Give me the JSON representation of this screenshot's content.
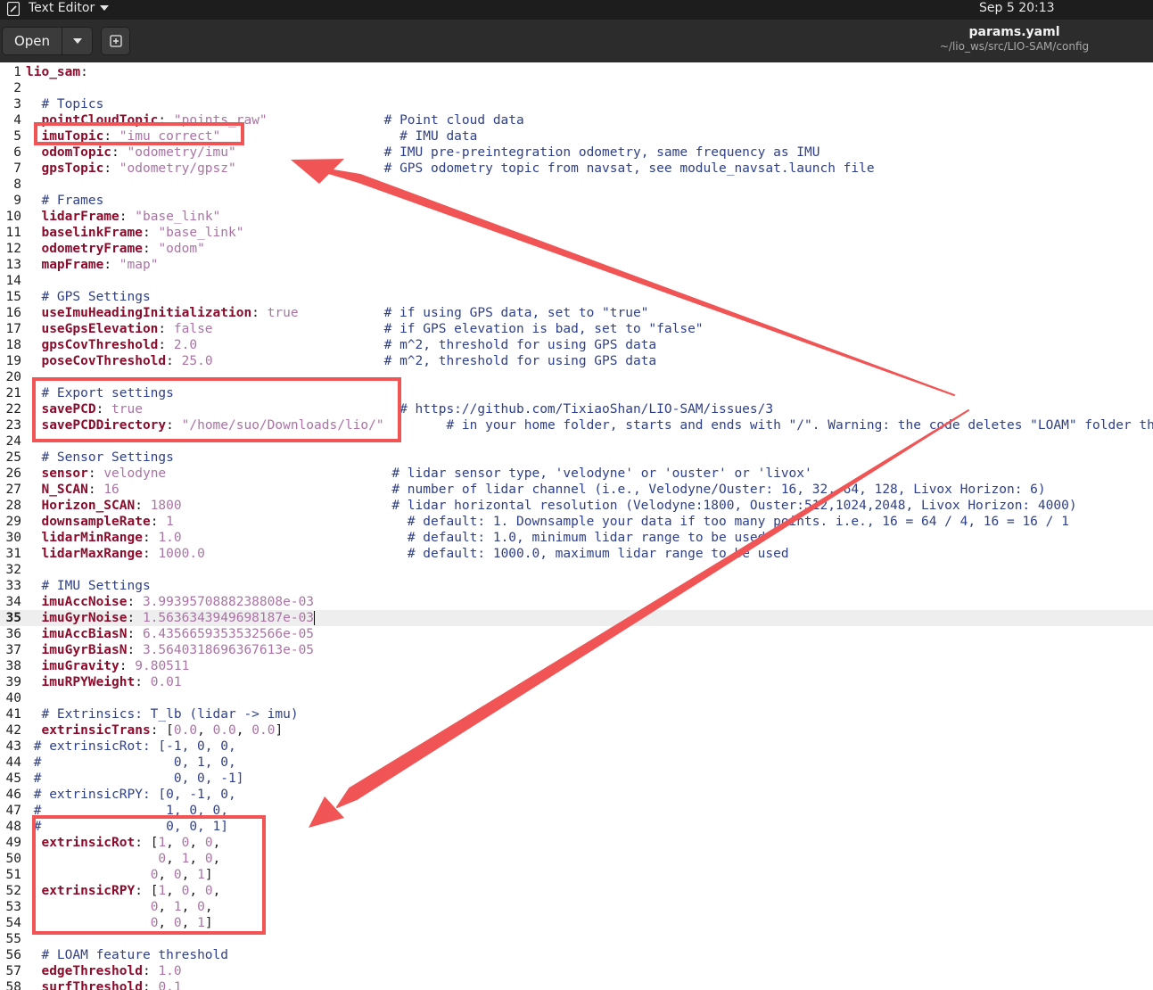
{
  "topbar": {
    "app_name": "Text Editor",
    "clock": "Sep 5  20:13"
  },
  "headerbar": {
    "open_label": "Open",
    "file_name": "params.yaml",
    "file_path": "~/lio_ws/src/LIO-SAM/config"
  },
  "colors": {
    "key": "#8b0b2b",
    "value": "#ab73a5",
    "comment": "#2e3f8c",
    "annotation": "#f05454"
  },
  "editor": {
    "current_line": 35,
    "lines": [
      {
        "n": 1,
        "parts": [
          [
            "k",
            "lio_sam"
          ],
          [
            "t",
            ":"
          ]
        ]
      },
      {
        "n": 2,
        "parts": []
      },
      {
        "n": 3,
        "parts": [
          [
            "t",
            "  "
          ],
          [
            "c",
            "# Topics"
          ]
        ]
      },
      {
        "n": 4,
        "parts": [
          [
            "t",
            "  "
          ],
          [
            "k",
            "pointCloudTopic"
          ],
          [
            "t",
            ": "
          ],
          [
            "v",
            "\"points_raw\""
          ],
          [
            "t",
            "               "
          ],
          [
            "c",
            "# Point cloud data"
          ]
        ]
      },
      {
        "n": 5,
        "parts": [
          [
            "t",
            "  "
          ],
          [
            "k",
            "imuTopic"
          ],
          [
            "t",
            ": "
          ],
          [
            "v",
            "\"imu_correct\""
          ],
          [
            "t",
            "                       "
          ],
          [
            "c",
            "# IMU data"
          ]
        ]
      },
      {
        "n": 6,
        "parts": [
          [
            "t",
            "  "
          ],
          [
            "k",
            "odomTopic"
          ],
          [
            "t",
            ": "
          ],
          [
            "v",
            "\"odometry/imu\""
          ],
          [
            "t",
            "                   "
          ],
          [
            "c",
            "# IMU pre-preintegration odometry, same frequency as IMU"
          ]
        ]
      },
      {
        "n": 7,
        "parts": [
          [
            "t",
            "  "
          ],
          [
            "k",
            "gpsTopic"
          ],
          [
            "t",
            ": "
          ],
          [
            "v",
            "\"odometry/gpsz\""
          ],
          [
            "t",
            "                   "
          ],
          [
            "c",
            "# GPS odometry topic from navsat, see module_navsat.launch file"
          ]
        ]
      },
      {
        "n": 8,
        "parts": []
      },
      {
        "n": 9,
        "parts": [
          [
            "t",
            "  "
          ],
          [
            "c",
            "# Frames"
          ]
        ]
      },
      {
        "n": 10,
        "parts": [
          [
            "t",
            "  "
          ],
          [
            "k",
            "lidarFrame"
          ],
          [
            "t",
            ": "
          ],
          [
            "v",
            "\"base_link\""
          ]
        ]
      },
      {
        "n": 11,
        "parts": [
          [
            "t",
            "  "
          ],
          [
            "k",
            "baselinkFrame"
          ],
          [
            "t",
            ": "
          ],
          [
            "v",
            "\"base_link\""
          ]
        ]
      },
      {
        "n": 12,
        "parts": [
          [
            "t",
            "  "
          ],
          [
            "k",
            "odometryFrame"
          ],
          [
            "t",
            ": "
          ],
          [
            "v",
            "\"odom\""
          ]
        ]
      },
      {
        "n": 13,
        "parts": [
          [
            "t",
            "  "
          ],
          [
            "k",
            "mapFrame"
          ],
          [
            "t",
            ": "
          ],
          [
            "v",
            "\"map\""
          ]
        ]
      },
      {
        "n": 14,
        "parts": []
      },
      {
        "n": 15,
        "parts": [
          [
            "t",
            "  "
          ],
          [
            "c",
            "# GPS Settings"
          ]
        ]
      },
      {
        "n": 16,
        "parts": [
          [
            "t",
            "  "
          ],
          [
            "k",
            "useImuHeadingInitialization"
          ],
          [
            "t",
            ": "
          ],
          [
            "v",
            "true"
          ],
          [
            "t",
            "           "
          ],
          [
            "c",
            "# if using GPS data, set to \"true\""
          ]
        ]
      },
      {
        "n": 17,
        "parts": [
          [
            "t",
            "  "
          ],
          [
            "k",
            "useGpsElevation"
          ],
          [
            "t",
            ": "
          ],
          [
            "v",
            "false"
          ],
          [
            "t",
            "                      "
          ],
          [
            "c",
            "# if GPS elevation is bad, set to \"false\""
          ]
        ]
      },
      {
        "n": 18,
        "parts": [
          [
            "t",
            "  "
          ],
          [
            "k",
            "gpsCovThreshold"
          ],
          [
            "t",
            ": "
          ],
          [
            "v",
            "2.0"
          ],
          [
            "t",
            "                        "
          ],
          [
            "c",
            "# m^2, threshold for using GPS data"
          ]
        ]
      },
      {
        "n": 19,
        "parts": [
          [
            "t",
            "  "
          ],
          [
            "k",
            "poseCovThreshold"
          ],
          [
            "t",
            ": "
          ],
          [
            "v",
            "25.0"
          ],
          [
            "t",
            "                      "
          ],
          [
            "c",
            "# m^2, threshold for using GPS data"
          ]
        ]
      },
      {
        "n": 20,
        "parts": []
      },
      {
        "n": 21,
        "parts": [
          [
            "t",
            "  "
          ],
          [
            "c",
            "# Export settings"
          ]
        ]
      },
      {
        "n": 22,
        "parts": [
          [
            "t",
            "  "
          ],
          [
            "k",
            "savePCD"
          ],
          [
            "t",
            ": "
          ],
          [
            "v",
            "true"
          ],
          [
            "t",
            "                                 "
          ],
          [
            "c",
            "# https://github.com/TixiaoShan/LIO-SAM/issues/3"
          ]
        ]
      },
      {
        "n": 23,
        "parts": [
          [
            "t",
            "  "
          ],
          [
            "k",
            "savePCDDirectory"
          ],
          [
            "t",
            ": "
          ],
          [
            "v",
            "\"/home/suo/Downloads/lio/\""
          ],
          [
            "t",
            "        "
          ],
          [
            "c",
            "# in your home folder, starts and ends with \"/\". Warning: the code deletes \"LOAM\" folder then recreates it. See \"mapOptimization\" for implementation"
          ]
        ]
      },
      {
        "n": 24,
        "parts": []
      },
      {
        "n": 25,
        "parts": [
          [
            "t",
            "  "
          ],
          [
            "c",
            "# Sensor Settings"
          ]
        ]
      },
      {
        "n": 26,
        "parts": [
          [
            "t",
            "  "
          ],
          [
            "k",
            "sensor"
          ],
          [
            "t",
            ": "
          ],
          [
            "v",
            "velodyne"
          ],
          [
            "t",
            "                             "
          ],
          [
            "c",
            "# lidar sensor type, 'velodyne' or 'ouster' or 'livox'"
          ]
        ]
      },
      {
        "n": 27,
        "parts": [
          [
            "t",
            "  "
          ],
          [
            "k",
            "N_SCAN"
          ],
          [
            "t",
            ": "
          ],
          [
            "v",
            "16"
          ],
          [
            "t",
            "                                   "
          ],
          [
            "c",
            "# number of lidar channel (i.e., Velodyne/Ouster: 16, 32, 64, 128, Livox Horizon: 6)"
          ]
        ]
      },
      {
        "n": 28,
        "parts": [
          [
            "t",
            "  "
          ],
          [
            "k",
            "Horizon_SCAN"
          ],
          [
            "t",
            ": "
          ],
          [
            "v",
            "1800"
          ],
          [
            "t",
            "                           "
          ],
          [
            "c",
            "# lidar horizontal resolution (Velodyne:1800, Ouster:512,1024,2048, Livox Horizon: 4000)"
          ]
        ]
      },
      {
        "n": 29,
        "parts": [
          [
            "t",
            "  "
          ],
          [
            "k",
            "downsampleRate"
          ],
          [
            "t",
            ": "
          ],
          [
            "v",
            "1"
          ],
          [
            "t",
            "                              "
          ],
          [
            "c",
            "# default: 1. Downsample your data if too many points. i.e., 16 = 64 / 4, 16 = 16 / 1"
          ]
        ]
      },
      {
        "n": 30,
        "parts": [
          [
            "t",
            "  "
          ],
          [
            "k",
            "lidarMinRange"
          ],
          [
            "t",
            ": "
          ],
          [
            "v",
            "1.0"
          ],
          [
            "t",
            "                             "
          ],
          [
            "c",
            "# default: 1.0, minimum lidar range to be used"
          ]
        ]
      },
      {
        "n": 31,
        "parts": [
          [
            "t",
            "  "
          ],
          [
            "k",
            "lidarMaxRange"
          ],
          [
            "t",
            ": "
          ],
          [
            "v",
            "1000.0"
          ],
          [
            "t",
            "                          "
          ],
          [
            "c",
            "# default: 1000.0, maximum lidar range to be used"
          ]
        ]
      },
      {
        "n": 32,
        "parts": []
      },
      {
        "n": 33,
        "parts": [
          [
            "t",
            "  "
          ],
          [
            "c",
            "# IMU Settings"
          ]
        ]
      },
      {
        "n": 34,
        "parts": [
          [
            "t",
            "  "
          ],
          [
            "k",
            "imuAccNoise"
          ],
          [
            "t",
            ": "
          ],
          [
            "v",
            "3.9939570888238808e-03"
          ]
        ]
      },
      {
        "n": 35,
        "parts": [
          [
            "t",
            "  "
          ],
          [
            "k",
            "imuGyrNoise"
          ],
          [
            "t",
            ": "
          ],
          [
            "v",
            "1.5636343949698187e-03"
          ],
          [
            "cursor",
            ""
          ]
        ]
      },
      {
        "n": 36,
        "parts": [
          [
            "t",
            "  "
          ],
          [
            "k",
            "imuAccBiasN"
          ],
          [
            "t",
            ": "
          ],
          [
            "v",
            "6.4356659353532566e-05"
          ]
        ]
      },
      {
        "n": 37,
        "parts": [
          [
            "t",
            "  "
          ],
          [
            "k",
            "imuGyrBiasN"
          ],
          [
            "t",
            ": "
          ],
          [
            "v",
            "3.5640318696367613e-05"
          ]
        ]
      },
      {
        "n": 38,
        "parts": [
          [
            "t",
            "  "
          ],
          [
            "k",
            "imuGravity"
          ],
          [
            "t",
            ": "
          ],
          [
            "v",
            "9.80511"
          ]
        ]
      },
      {
        "n": 39,
        "parts": [
          [
            "t",
            "  "
          ],
          [
            "k",
            "imuRPYWeight"
          ],
          [
            "t",
            ": "
          ],
          [
            "v",
            "0.01"
          ]
        ]
      },
      {
        "n": 40,
        "parts": []
      },
      {
        "n": 41,
        "parts": [
          [
            "t",
            "  "
          ],
          [
            "c",
            "# Extrinsics: T_lb (lidar -> imu)"
          ]
        ]
      },
      {
        "n": 42,
        "parts": [
          [
            "t",
            "  "
          ],
          [
            "k",
            "extrinsicTrans"
          ],
          [
            "t",
            ": ["
          ],
          [
            "v",
            "0.0"
          ],
          [
            "t",
            ", "
          ],
          [
            "v",
            "0.0"
          ],
          [
            "t",
            ", "
          ],
          [
            "v",
            "0.0"
          ],
          [
            "t",
            "]"
          ]
        ]
      },
      {
        "n": 43,
        "parts": [
          [
            "t",
            " "
          ],
          [
            "c",
            "# extrinsicRot: [-1, 0, 0,"
          ]
        ]
      },
      {
        "n": 44,
        "parts": [
          [
            "t",
            " "
          ],
          [
            "c",
            "#                 0, 1, 0,"
          ]
        ]
      },
      {
        "n": 45,
        "parts": [
          [
            "t",
            " "
          ],
          [
            "c",
            "#                 0, 0, -1]"
          ]
        ]
      },
      {
        "n": 46,
        "parts": [
          [
            "t",
            " "
          ],
          [
            "c",
            "# extrinsicRPY: [0, -1, 0,"
          ]
        ]
      },
      {
        "n": 47,
        "parts": [
          [
            "t",
            " "
          ],
          [
            "c",
            "#                1, 0, 0,"
          ]
        ]
      },
      {
        "n": 48,
        "parts": [
          [
            "t",
            " "
          ],
          [
            "c",
            "#                0, 0, 1]"
          ]
        ]
      },
      {
        "n": 49,
        "parts": [
          [
            "t",
            "  "
          ],
          [
            "k",
            "extrinsicRot"
          ],
          [
            "t",
            ": ["
          ],
          [
            "v",
            "1"
          ],
          [
            "t",
            ", "
          ],
          [
            "v",
            "0"
          ],
          [
            "t",
            ", "
          ],
          [
            "v",
            "0"
          ],
          [
            "t",
            ","
          ]
        ]
      },
      {
        "n": 50,
        "parts": [
          [
            "t",
            "                 "
          ],
          [
            "v",
            "0"
          ],
          [
            "t",
            ", "
          ],
          [
            "v",
            "1"
          ],
          [
            "t",
            ", "
          ],
          [
            "v",
            "0"
          ],
          [
            "t",
            ","
          ]
        ]
      },
      {
        "n": 51,
        "parts": [
          [
            "t",
            "                "
          ],
          [
            "v",
            "0"
          ],
          [
            "t",
            ", "
          ],
          [
            "v",
            "0"
          ],
          [
            "t",
            ", "
          ],
          [
            "v",
            "1"
          ],
          [
            "t",
            "]"
          ]
        ]
      },
      {
        "n": 52,
        "parts": [
          [
            "t",
            "  "
          ],
          [
            "k",
            "extrinsicRPY"
          ],
          [
            "t",
            ": ["
          ],
          [
            "v",
            "1"
          ],
          [
            "t",
            ", "
          ],
          [
            "v",
            "0"
          ],
          [
            "t",
            ", "
          ],
          [
            "v",
            "0"
          ],
          [
            "t",
            ","
          ]
        ]
      },
      {
        "n": 53,
        "parts": [
          [
            "t",
            "                "
          ],
          [
            "v",
            "0"
          ],
          [
            "t",
            ", "
          ],
          [
            "v",
            "1"
          ],
          [
            "t",
            ", "
          ],
          [
            "v",
            "0"
          ],
          [
            "t",
            ","
          ]
        ]
      },
      {
        "n": 54,
        "parts": [
          [
            "t",
            "                "
          ],
          [
            "v",
            "0"
          ],
          [
            "t",
            ", "
          ],
          [
            "v",
            "0"
          ],
          [
            "t",
            ", "
          ],
          [
            "v",
            "1"
          ],
          [
            "t",
            "]"
          ]
        ]
      },
      {
        "n": 55,
        "parts": []
      },
      {
        "n": 56,
        "parts": [
          [
            "t",
            "  "
          ],
          [
            "c",
            "# LOAM feature threshold"
          ]
        ]
      },
      {
        "n": 57,
        "parts": [
          [
            "t",
            "  "
          ],
          [
            "k",
            "edgeThreshold"
          ],
          [
            "t",
            ": "
          ],
          [
            "v",
            "1.0"
          ]
        ]
      },
      {
        "n": 58,
        "parts": [
          [
            "t",
            "  "
          ],
          [
            "k",
            "surfThreshold"
          ],
          [
            "t",
            ": "
          ],
          [
            "v",
            "0.1"
          ]
        ]
      }
    ]
  }
}
